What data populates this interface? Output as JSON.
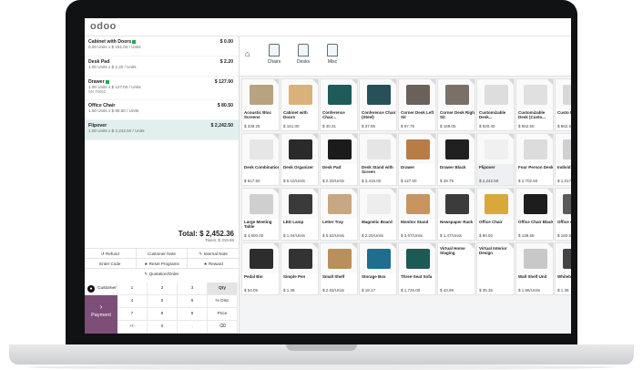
{
  "app": {
    "logo": "odoo"
  },
  "order_lines": [
    {
      "name": "Cabinet with Doors",
      "badge": true,
      "detail": "0.00  Units x $ 161.00 / Units",
      "price": "$ 0.00",
      "note": "",
      "selected": false
    },
    {
      "name": "Desk Pad",
      "badge": false,
      "detail": "1.00  Units x $ 2.20 / Units",
      "price": "$ 2.20",
      "note": "",
      "selected": false
    },
    {
      "name": "Drawer",
      "badge": true,
      "detail": "1.00  Units x $ 127.00 / Units",
      "price": "$ 127.00",
      "note": "SN 76062",
      "selected": false
    },
    {
      "name": "Office Chair",
      "badge": false,
      "detail": "1.00  Units x $ 80.50 / Units",
      "price": "$ 80.50",
      "note": "",
      "selected": false
    },
    {
      "name": "Flipover",
      "badge": false,
      "detail": "1.00  Units x $ 2,242.50 / Units",
      "price": "$ 2,242.50",
      "note": "",
      "selected": true
    }
  ],
  "total": {
    "label": "Total: $ 2,452.36",
    "taxes": "Taxes: $ 319.86"
  },
  "controls_row1": [
    "↺ Refund",
    "Customer Note",
    "✎ Internal Note"
  ],
  "controls_row2": [
    "Enter Code",
    "★ Reset Programs",
    "★ Reward"
  ],
  "controls_row3": [
    "✎ Quotation/Order"
  ],
  "keypad": {
    "customer": "Customer",
    "payment": "Payment",
    "payment_icon": "›",
    "keys": [
      [
        "1",
        "2",
        "3",
        "Qty"
      ],
      [
        "4",
        "5",
        "6",
        "% Disc"
      ],
      [
        "7",
        "8",
        "9",
        "Price"
      ],
      [
        "+/-",
        "0",
        ".",
        "⌫"
      ]
    ]
  },
  "categories": [
    "Chairs",
    "Desks",
    "Misc"
  ],
  "products": [
    {
      "name": "Acoustic Bloc Screens",
      "price": "$ 339.25",
      "color": "#b7a37f"
    },
    {
      "name": "Cabinet with Doors",
      "price": "$ 161.00",
      "color": "#d8b27a"
    },
    {
      "name": "Conference Chair...",
      "price": "$ 40.31",
      "color": "#1f5b5b"
    },
    {
      "name": "Conference Chair (Steel)",
      "price": "$ 37.95",
      "color": "#26505a"
    },
    {
      "name": "Corner Desk Left Sit",
      "price": "$ 97.75",
      "color": "#6a625a"
    },
    {
      "name": "Corner Desk Right Sit",
      "price": "$ 169.05",
      "color": "#7a7068"
    },
    {
      "name": "Customizable Desk...",
      "price": "$ 920.40",
      "color": "#dddddd"
    },
    {
      "name": "Customizable Desk (Custo...",
      "price": "$ 862.50",
      "color": "#e0e0e0"
    },
    {
      "name": "Custo Desk (C",
      "price": "$ 862.5",
      "color": "#d8d8d8"
    },
    {
      "name": "Desk Combination",
      "price": "$ 517.50",
      "color": "#e6e6e6"
    },
    {
      "name": "Desk Organizer",
      "price": "$ 5.10/Units",
      "color": "#2a2a2a"
    },
    {
      "name": "Desk Pad",
      "price": "$ 2.20/Units",
      "color": "#1b1b1b"
    },
    {
      "name": "Desk Stand with Screen",
      "price": "$ 2,415.00",
      "color": "#e5e5e5"
    },
    {
      "name": "Drawer",
      "price": "$ 127.00",
      "color": "#b87d47"
    },
    {
      "name": "Drawer Black",
      "price": "$ 28.75",
      "color": "#202020"
    },
    {
      "name": "Flipover",
      "price": "$ 2,242.50",
      "color": "#f0f0f0"
    },
    {
      "name": "Four Person Desk",
      "price": "$ 2,702.50",
      "color": "#dcdcdc"
    },
    {
      "name": "Individ Workpl",
      "price": "$ 1,017",
      "color": "#d0d0d0"
    },
    {
      "name": "Large Meeting Table",
      "price": "$ 4,600.00",
      "color": "#cfcfcf"
    },
    {
      "name": "LED Lamp",
      "price": "$ 1.04/Units",
      "color": "#3a3a3a"
    },
    {
      "name": "Letter Tray",
      "price": "$ 5.52/Units",
      "color": "#c8a882"
    },
    {
      "name": "Magnetic Board",
      "price": "$ 2.20/Units",
      "color": "#ededed"
    },
    {
      "name": "Monitor Stand",
      "price": "$ 3.67/Units",
      "color": "#c9955e"
    },
    {
      "name": "Newspaper Rack",
      "price": "$ 1.47/Units",
      "color": "#3b3b3b"
    },
    {
      "name": "Office Chair",
      "price": "$ 80.50",
      "color": "#d6a93a"
    },
    {
      "name": "Office Chair Black",
      "price": "$ 138.58",
      "color": "#1d1d1d"
    },
    {
      "name": "Office ch",
      "price": "$ 160.6",
      "color": "#5a5a5a"
    },
    {
      "name": "Pedal Bin",
      "price": "$ 54.05",
      "color": "#2d2d2d"
    },
    {
      "name": "Simple Pen",
      "price": "$ 1.38",
      "color": "#333333"
    },
    {
      "name": "Small Shelf",
      "price": "$ 2.83/Units",
      "color": "#b98f5c"
    },
    {
      "name": "Storage Box",
      "price": "$ 18.17",
      "color": "#1f6d8f"
    },
    {
      "name": "Three-Seat Sofa",
      "price": "$ 1,725.00",
      "color": "#1e5a55"
    },
    {
      "name": "Virtual Home Staging",
      "price": "$ 43.99",
      "color": ""
    },
    {
      "name": "Virtual Interior Design",
      "price": "$ 35.36",
      "color": ""
    },
    {
      "name": "Wall Shelf Unit",
      "price": "$ 1.98/Units",
      "color": "#c8c8c8"
    },
    {
      "name": "Whiteb Pen",
      "price": "$ 1.38",
      "color": "#444444"
    }
  ]
}
